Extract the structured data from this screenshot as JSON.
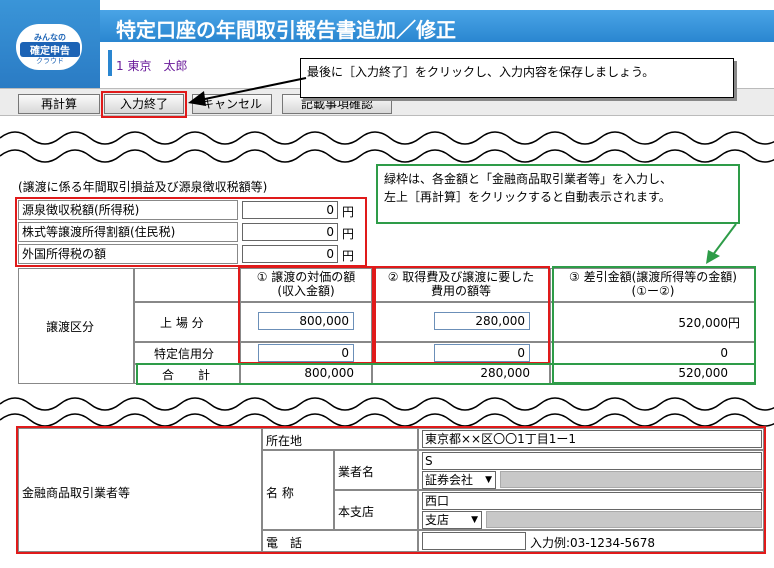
{
  "logo": {
    "line1": "みんなの",
    "line2": "確定申告",
    "line3": "クラウド"
  },
  "header": {
    "title": "特定口座の年間取引報告書追加／修正",
    "user": "1 東京　太郎"
  },
  "callouts": {
    "top": "最後に［入力終了］をクリックし、入力内容を保存しましょう。",
    "green_line1": "緑枠は、各金額と「金融商品取引業者等」を入力し、",
    "green_line2": "左上［再計算］をクリックすると自動表示されます。"
  },
  "toolbar": {
    "recalc": "再計算",
    "finish": "入力終了",
    "cancel": "キャンセル",
    "confirm": "記載事項確認"
  },
  "section_title": "(譲渡に係る年間取引損益及び源泉徴収税額等)",
  "tax": {
    "rows": [
      {
        "label": "源泉徴収税額(所得税)",
        "value": "0",
        "unit": "円"
      },
      {
        "label": "株式等譲渡所得割額(住民税)",
        "value": "0",
        "unit": "円"
      },
      {
        "label": "外国所得税の額",
        "value": "0",
        "unit": "円"
      }
    ]
  },
  "transfer": {
    "category_label": "譲渡区分",
    "col1_line1": "①  譲渡の対価の額",
    "col1_line2": "(収入金額)",
    "col2_line1": "②  取得費及び譲渡に要した",
    "col2_line2": "費用の額等",
    "col3_line1": "③  差引金額(譲渡所得等の金額)",
    "col3_line2": "(①ー②)",
    "row_listed": {
      "label": "上 場 分",
      "v1": "800,000",
      "v2": "280,000",
      "v3": "520,000円"
    },
    "row_margin": {
      "label": "特定信用分",
      "v1": "0",
      "v2": "0",
      "v3": "0"
    },
    "row_total": {
      "label": "合　　計",
      "v1": "800,000",
      "v2": "280,000",
      "v3": "520,000"
    }
  },
  "broker": {
    "label": "金融商品取引業者等",
    "address_label": "所在地",
    "address_value": "東京都××区〇〇1丁目1ー1",
    "name_label": "名 称",
    "company_label": "業者名",
    "company_value": "S",
    "company_select": "証券会社",
    "branch_label": "本支店",
    "branch_value": "西口",
    "branch_select": "支店",
    "phone_label": "電　話",
    "phone_hint": "入力例:03-1234-5678"
  },
  "colors": {
    "accent_red": "#e01a1a",
    "accent_green": "#2e9c48",
    "header_blue": "#2a86d0"
  }
}
